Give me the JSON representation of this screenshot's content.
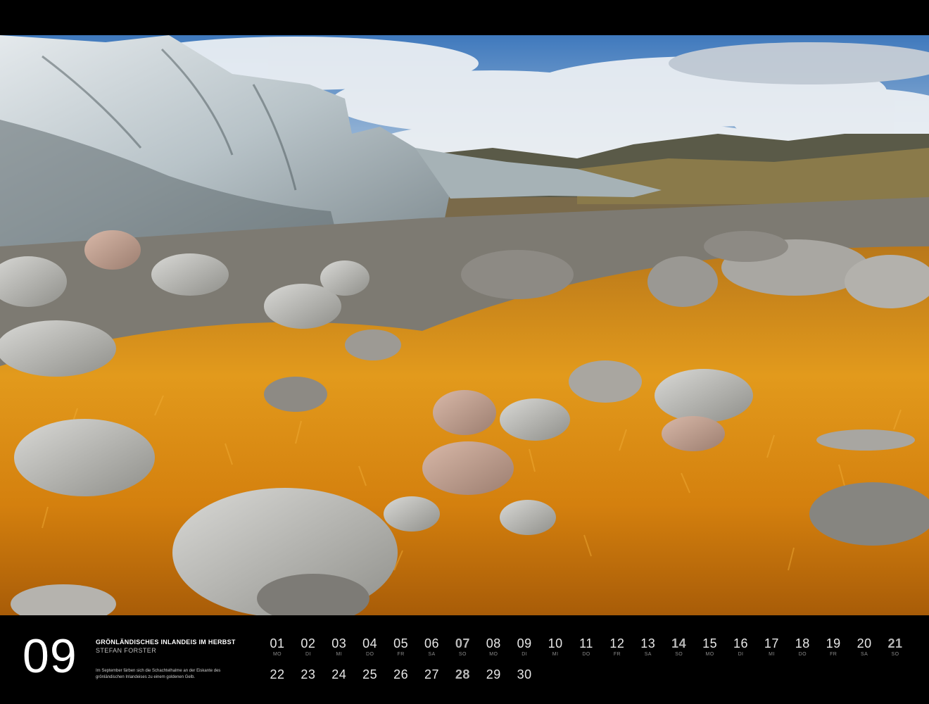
{
  "month": {
    "number": "09"
  },
  "caption": {
    "title": "GRÖNLÄNDISCHES INLANDEIS IM HERBST",
    "author": "STEFAN FORSTER",
    "text": "Im September färben sich die Schachtelhalme an der Eiskante des grönländischen Inlandeises zu einem goldenen Gelb."
  },
  "days_row1": [
    {
      "num": "01",
      "wd": "MO",
      "sunday": false
    },
    {
      "num": "02",
      "wd": "DI",
      "sunday": false
    },
    {
      "num": "03",
      "wd": "MI",
      "sunday": false
    },
    {
      "num": "04",
      "wd": "DO",
      "sunday": false
    },
    {
      "num": "05",
      "wd": "FR",
      "sunday": false
    },
    {
      "num": "06",
      "wd": "SA",
      "sunday": false
    },
    {
      "num": "07",
      "wd": "SO",
      "sunday": true
    },
    {
      "num": "08",
      "wd": "MO",
      "sunday": false
    },
    {
      "num": "09",
      "wd": "DI",
      "sunday": false
    },
    {
      "num": "10",
      "wd": "MI",
      "sunday": false
    },
    {
      "num": "11",
      "wd": "DO",
      "sunday": false
    },
    {
      "num": "12",
      "wd": "FR",
      "sunday": false
    },
    {
      "num": "13",
      "wd": "SA",
      "sunday": false
    },
    {
      "num": "14",
      "wd": "SO",
      "sunday": true
    },
    {
      "num": "15",
      "wd": "MO",
      "sunday": false
    },
    {
      "num": "16",
      "wd": "DI",
      "sunday": false
    },
    {
      "num": "17",
      "wd": "MI",
      "sunday": false
    },
    {
      "num": "18",
      "wd": "DO",
      "sunday": false
    },
    {
      "num": "19",
      "wd": "FR",
      "sunday": false
    },
    {
      "num": "20",
      "wd": "SA",
      "sunday": false
    },
    {
      "num": "21",
      "wd": "SO",
      "sunday": true
    }
  ],
  "days_row2": [
    {
      "num": "22",
      "sunday": false
    },
    {
      "num": "23",
      "sunday": false
    },
    {
      "num": "24",
      "sunday": false
    },
    {
      "num": "25",
      "sunday": false
    },
    {
      "num": "26",
      "sunday": false
    },
    {
      "num": "27",
      "sunday": false
    },
    {
      "num": "28",
      "sunday": true
    },
    {
      "num": "29",
      "sunday": false
    },
    {
      "num": "30",
      "sunday": false
    }
  ],
  "colors": {
    "background": "#000000",
    "grass": "#d98a14",
    "sky": "#4a86c8",
    "ice": "#c9d2d6"
  }
}
